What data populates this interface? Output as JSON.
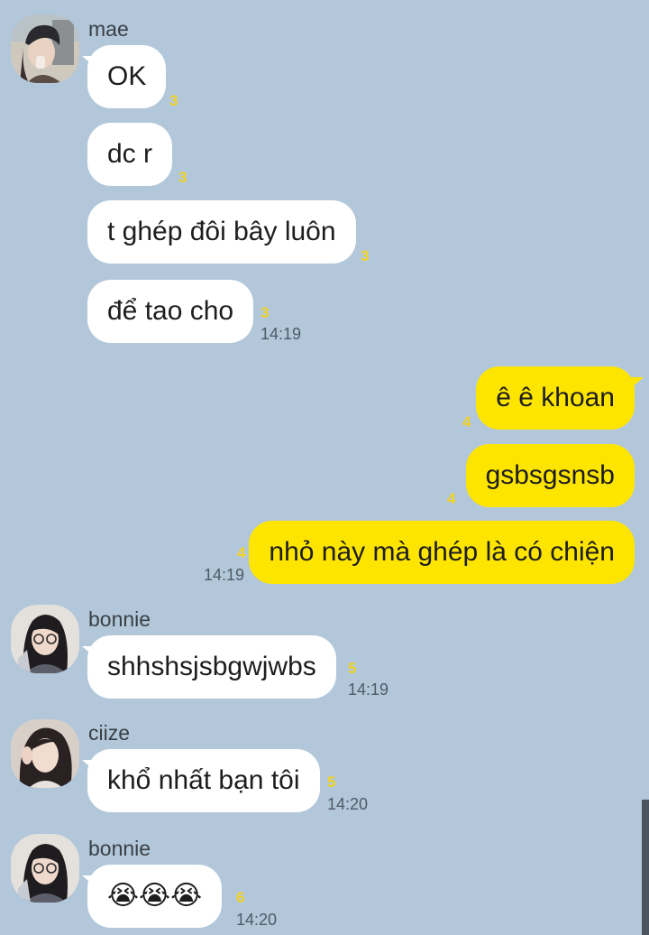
{
  "colors": {
    "background": "#b2c7da",
    "incoming_bubble": "#ffffff",
    "outgoing_bubble": "#fee500",
    "unread_count": "#f2d324",
    "time_text": "#4f5a66"
  },
  "groups": [
    {
      "sender": "mae",
      "avatar_icon": "profile-photo-mae",
      "messages": [
        {
          "text": "OK",
          "unread": "3"
        },
        {
          "text": "dc r",
          "unread": "3"
        },
        {
          "text": "t ghép đôi bây luôn",
          "unread": "3"
        },
        {
          "text": "để tao cho",
          "unread": "3",
          "time": "14:19"
        }
      ]
    },
    {
      "sender": "me",
      "messages": [
        {
          "text": "ê ê khoan",
          "unread": "4"
        },
        {
          "text": "gsbsgsnsb",
          "unread": "4"
        },
        {
          "text": "nhỏ này mà ghép là có chiện",
          "unread": "4",
          "time": "14:19"
        }
      ]
    },
    {
      "sender": "bonnie",
      "avatar_icon": "profile-photo-bonnie",
      "messages": [
        {
          "text": "shhshsjsbgwjwbs",
          "unread": "5",
          "time": "14:19"
        }
      ]
    },
    {
      "sender": "ciize",
      "avatar_icon": "profile-photo-ciize",
      "messages": [
        {
          "text": "khổ nhất bạn tôi",
          "unread": "5",
          "time": "14:20"
        }
      ]
    },
    {
      "sender": "bonnie",
      "avatar_icon": "profile-photo-bonnie",
      "messages": [
        {
          "text": "😭😭😭",
          "unread": "6",
          "time": "14:20"
        }
      ]
    }
  ]
}
